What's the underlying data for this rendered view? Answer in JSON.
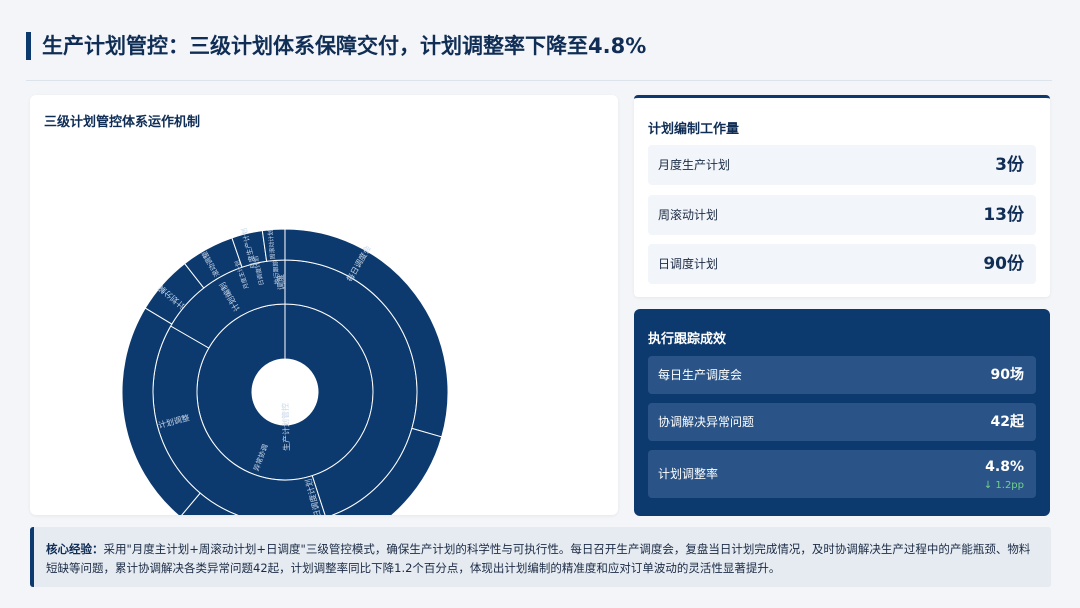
{
  "header": {
    "title": "生产计划管控：三级计划体系保障交付，计划调整率下降至4.8%"
  },
  "sunburst": {
    "title": "三级计划管控体系运作机制",
    "fill_color": "#0d3a6e",
    "inner_label": "生产计划管控",
    "labels": [
      "日调度计划",
      "计划调整",
      "计划编制",
      "调度",
      "每日调度会",
      "计划分解",
      "滚动调整",
      "月度生产计划",
      "周滚动计划",
      "日调度计划",
      "执行跟踪",
      "异常协调",
      "月度主计划"
    ]
  },
  "workload": {
    "title": "计划编制工作量",
    "items": [
      {
        "label": "月度生产计划",
        "value": "3份"
      },
      {
        "label": "周滚动计划",
        "value": "13份"
      },
      {
        "label": "日调度计划",
        "value": "90份"
      }
    ]
  },
  "execution": {
    "title": "执行跟踪成效",
    "items": [
      {
        "label": "每日生产调度会",
        "value": "90场"
      },
      {
        "label": "协调解决异常问题",
        "value": "42起"
      },
      {
        "label": "计划调整率",
        "value": "4.8%",
        "delta": "↓ 1.2pp"
      }
    ]
  },
  "note": {
    "label": "核心经验：",
    "text": "采用\"月度主计划+周滚动计划+日调度\"三级管控模式，确保生产计划的科学性与可执行性。每日召开生产调度会，复盘当日计划完成情况，及时协调解决生产过程中的产能瓶颈、物料短缺等问题，累计协调解决各类异常问题42起，计划调整率同比下降1.2个百分点，体现出计划编制的精准度和应对订单波动的灵活性显著提升。"
  }
}
